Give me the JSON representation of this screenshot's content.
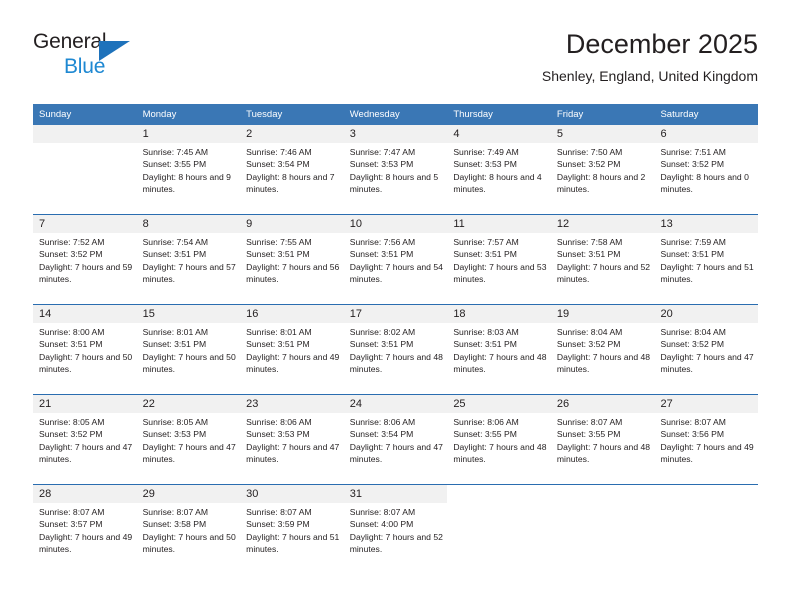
{
  "brand": {
    "name_line1": "General",
    "name_line2": "Blue",
    "triangle_icon": "triangle-icon",
    "color_dark": "#231f20",
    "color_blue": "#1e88d2"
  },
  "header": {
    "title": "December 2025",
    "subtitle": "Shenley, England, United Kingdom"
  },
  "theme": {
    "header_blue": "#3a77b5",
    "row_divider_blue": "#2a6db0",
    "day_band_gray": "#f1f1f1"
  },
  "weekdays": [
    "Sunday",
    "Monday",
    "Tuesday",
    "Wednesday",
    "Thursday",
    "Friday",
    "Saturday"
  ],
  "weeks": [
    [
      {
        "day": "",
        "empty": true
      },
      {
        "day": "1",
        "sunrise": "Sunrise: 7:45 AM",
        "sunset": "Sunset: 3:55 PM",
        "daylight": "Daylight: 8 hours and 9 minutes."
      },
      {
        "day": "2",
        "sunrise": "Sunrise: 7:46 AM",
        "sunset": "Sunset: 3:54 PM",
        "daylight": "Daylight: 8 hours and 7 minutes."
      },
      {
        "day": "3",
        "sunrise": "Sunrise: 7:47 AM",
        "sunset": "Sunset: 3:53 PM",
        "daylight": "Daylight: 8 hours and 5 minutes."
      },
      {
        "day": "4",
        "sunrise": "Sunrise: 7:49 AM",
        "sunset": "Sunset: 3:53 PM",
        "daylight": "Daylight: 8 hours and 4 minutes."
      },
      {
        "day": "5",
        "sunrise": "Sunrise: 7:50 AM",
        "sunset": "Sunset: 3:52 PM",
        "daylight": "Daylight: 8 hours and 2 minutes."
      },
      {
        "day": "6",
        "sunrise": "Sunrise: 7:51 AM",
        "sunset": "Sunset: 3:52 PM",
        "daylight": "Daylight: 8 hours and 0 minutes."
      }
    ],
    [
      {
        "day": "7",
        "sunrise": "Sunrise: 7:52 AM",
        "sunset": "Sunset: 3:52 PM",
        "daylight": "Daylight: 7 hours and 59 minutes."
      },
      {
        "day": "8",
        "sunrise": "Sunrise: 7:54 AM",
        "sunset": "Sunset: 3:51 PM",
        "daylight": "Daylight: 7 hours and 57 minutes."
      },
      {
        "day": "9",
        "sunrise": "Sunrise: 7:55 AM",
        "sunset": "Sunset: 3:51 PM",
        "daylight": "Daylight: 7 hours and 56 minutes."
      },
      {
        "day": "10",
        "sunrise": "Sunrise: 7:56 AM",
        "sunset": "Sunset: 3:51 PM",
        "daylight": "Daylight: 7 hours and 54 minutes."
      },
      {
        "day": "11",
        "sunrise": "Sunrise: 7:57 AM",
        "sunset": "Sunset: 3:51 PM",
        "daylight": "Daylight: 7 hours and 53 minutes."
      },
      {
        "day": "12",
        "sunrise": "Sunrise: 7:58 AM",
        "sunset": "Sunset: 3:51 PM",
        "daylight": "Daylight: 7 hours and 52 minutes."
      },
      {
        "day": "13",
        "sunrise": "Sunrise: 7:59 AM",
        "sunset": "Sunset: 3:51 PM",
        "daylight": "Daylight: 7 hours and 51 minutes."
      }
    ],
    [
      {
        "day": "14",
        "sunrise": "Sunrise: 8:00 AM",
        "sunset": "Sunset: 3:51 PM",
        "daylight": "Daylight: 7 hours and 50 minutes."
      },
      {
        "day": "15",
        "sunrise": "Sunrise: 8:01 AM",
        "sunset": "Sunset: 3:51 PM",
        "daylight": "Daylight: 7 hours and 50 minutes."
      },
      {
        "day": "16",
        "sunrise": "Sunrise: 8:01 AM",
        "sunset": "Sunset: 3:51 PM",
        "daylight": "Daylight: 7 hours and 49 minutes."
      },
      {
        "day": "17",
        "sunrise": "Sunrise: 8:02 AM",
        "sunset": "Sunset: 3:51 PM",
        "daylight": "Daylight: 7 hours and 48 minutes."
      },
      {
        "day": "18",
        "sunrise": "Sunrise: 8:03 AM",
        "sunset": "Sunset: 3:51 PM",
        "daylight": "Daylight: 7 hours and 48 minutes."
      },
      {
        "day": "19",
        "sunrise": "Sunrise: 8:04 AM",
        "sunset": "Sunset: 3:52 PM",
        "daylight": "Daylight: 7 hours and 48 minutes."
      },
      {
        "day": "20",
        "sunrise": "Sunrise: 8:04 AM",
        "sunset": "Sunset: 3:52 PM",
        "daylight": "Daylight: 7 hours and 47 minutes."
      }
    ],
    [
      {
        "day": "21",
        "sunrise": "Sunrise: 8:05 AM",
        "sunset": "Sunset: 3:52 PM",
        "daylight": "Daylight: 7 hours and 47 minutes."
      },
      {
        "day": "22",
        "sunrise": "Sunrise: 8:05 AM",
        "sunset": "Sunset: 3:53 PM",
        "daylight": "Daylight: 7 hours and 47 minutes."
      },
      {
        "day": "23",
        "sunrise": "Sunrise: 8:06 AM",
        "sunset": "Sunset: 3:53 PM",
        "daylight": "Daylight: 7 hours and 47 minutes."
      },
      {
        "day": "24",
        "sunrise": "Sunrise: 8:06 AM",
        "sunset": "Sunset: 3:54 PM",
        "daylight": "Daylight: 7 hours and 47 minutes."
      },
      {
        "day": "25",
        "sunrise": "Sunrise: 8:06 AM",
        "sunset": "Sunset: 3:55 PM",
        "daylight": "Daylight: 7 hours and 48 minutes."
      },
      {
        "day": "26",
        "sunrise": "Sunrise: 8:07 AM",
        "sunset": "Sunset: 3:55 PM",
        "daylight": "Daylight: 7 hours and 48 minutes."
      },
      {
        "day": "27",
        "sunrise": "Sunrise: 8:07 AM",
        "sunset": "Sunset: 3:56 PM",
        "daylight": "Daylight: 7 hours and 49 minutes."
      }
    ],
    [
      {
        "day": "28",
        "sunrise": "Sunrise: 8:07 AM",
        "sunset": "Sunset: 3:57 PM",
        "daylight": "Daylight: 7 hours and 49 minutes."
      },
      {
        "day": "29",
        "sunrise": "Sunrise: 8:07 AM",
        "sunset": "Sunset: 3:58 PM",
        "daylight": "Daylight: 7 hours and 50 minutes."
      },
      {
        "day": "30",
        "sunrise": "Sunrise: 8:07 AM",
        "sunset": "Sunset: 3:59 PM",
        "daylight": "Daylight: 7 hours and 51 minutes."
      },
      {
        "day": "31",
        "sunrise": "Sunrise: 8:07 AM",
        "sunset": "Sunset: 4:00 PM",
        "daylight": "Daylight: 7 hours and 52 minutes."
      },
      {
        "day": "",
        "empty": true,
        "blank": true
      },
      {
        "day": "",
        "empty": true,
        "blank": true
      },
      {
        "day": "",
        "empty": true,
        "blank": true
      }
    ]
  ]
}
